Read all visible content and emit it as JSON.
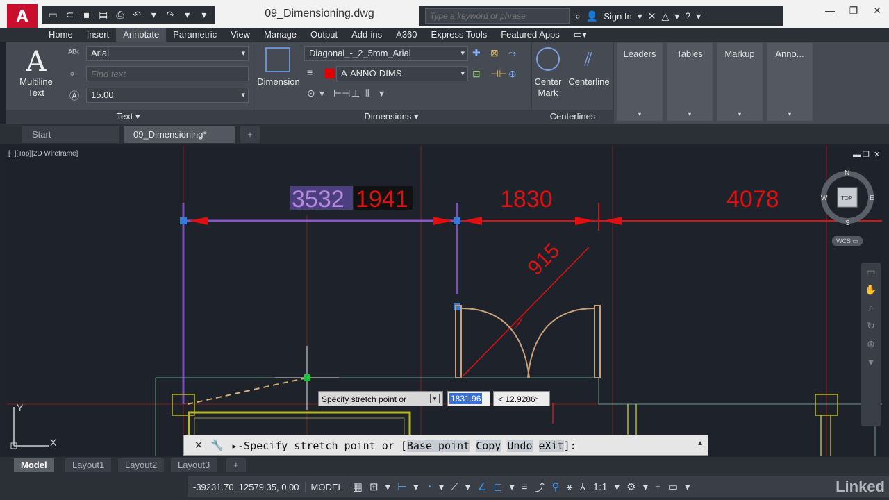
{
  "app": {
    "logo": "A"
  },
  "title": {
    "document": "09_Dimensioning.dwg"
  },
  "quick_access": {
    "icons": [
      "new-icon",
      "open-icon",
      "save-icon",
      "saveas-icon",
      "print-icon",
      "undo-icon",
      "redo-icon"
    ]
  },
  "search": {
    "placeholder": "Type a keyword or phrase"
  },
  "account": {
    "signin": "Sign In"
  },
  "ribbon_tabs": [
    "Home",
    "Insert",
    "Annotate",
    "Parametric",
    "View",
    "Manage",
    "Output",
    "Add-ins",
    "A360",
    "Express Tools",
    "Featured Apps"
  ],
  "ribbon_active_tab": "Annotate",
  "text_panel": {
    "big_button_glyph": "A",
    "big_button_label_1": "Multiline",
    "big_button_label_2": "Text",
    "font": "Arial",
    "find_placeholder": "Find text",
    "height": "15.00",
    "footer": "Text ▾"
  },
  "dimensions_panel": {
    "big_button_label": "Dimension",
    "style": "Diagonal_-_2_5mm_Arial",
    "layer": "A-ANNO-DIMS",
    "footer": "Dimensions ▾"
  },
  "centerlines_panel": {
    "center_mark_1": "Center",
    "center_mark_2": "Mark",
    "centerline": "Centerline",
    "footer": "Centerlines"
  },
  "more_panels": [
    "Leaders",
    "Tables",
    "Markup",
    "Anno..."
  ],
  "file_tabs": {
    "start": "Start",
    "active": "09_Dimensioning*",
    "add": "+"
  },
  "viewport": {
    "label": "[−][Top][2D Wireframe]"
  },
  "dimensions": {
    "d1": "3532",
    "d2": "1941",
    "d3": "1830",
    "d4": "4078",
    "d5": "915"
  },
  "viewcube": {
    "top": "TOP",
    "n": "N",
    "s": "S",
    "e": "E",
    "w": "W",
    "wcs": "WCS ▭"
  },
  "ucs": {
    "x": "X",
    "y": "Y"
  },
  "dynamic_input": {
    "prompt": "Specify stretch point or",
    "distance": "1831.96",
    "angle": "< 12.9286°"
  },
  "command_line": {
    "prefix": "▸-Specify stretch point or [",
    "kw_base": "Base point",
    "kw_copy": "Copy",
    "kw_undo": "Undo",
    "kw_exit": "eXit",
    "suffix": "]:"
  },
  "layout_tabs": [
    "Model",
    "Layout1",
    "Layout2",
    "Layout3"
  ],
  "status": {
    "coords": "-39231.70, 12579.35, 0.00",
    "model": "MODEL",
    "scale": "1:1"
  },
  "watermark": "Linked"
}
